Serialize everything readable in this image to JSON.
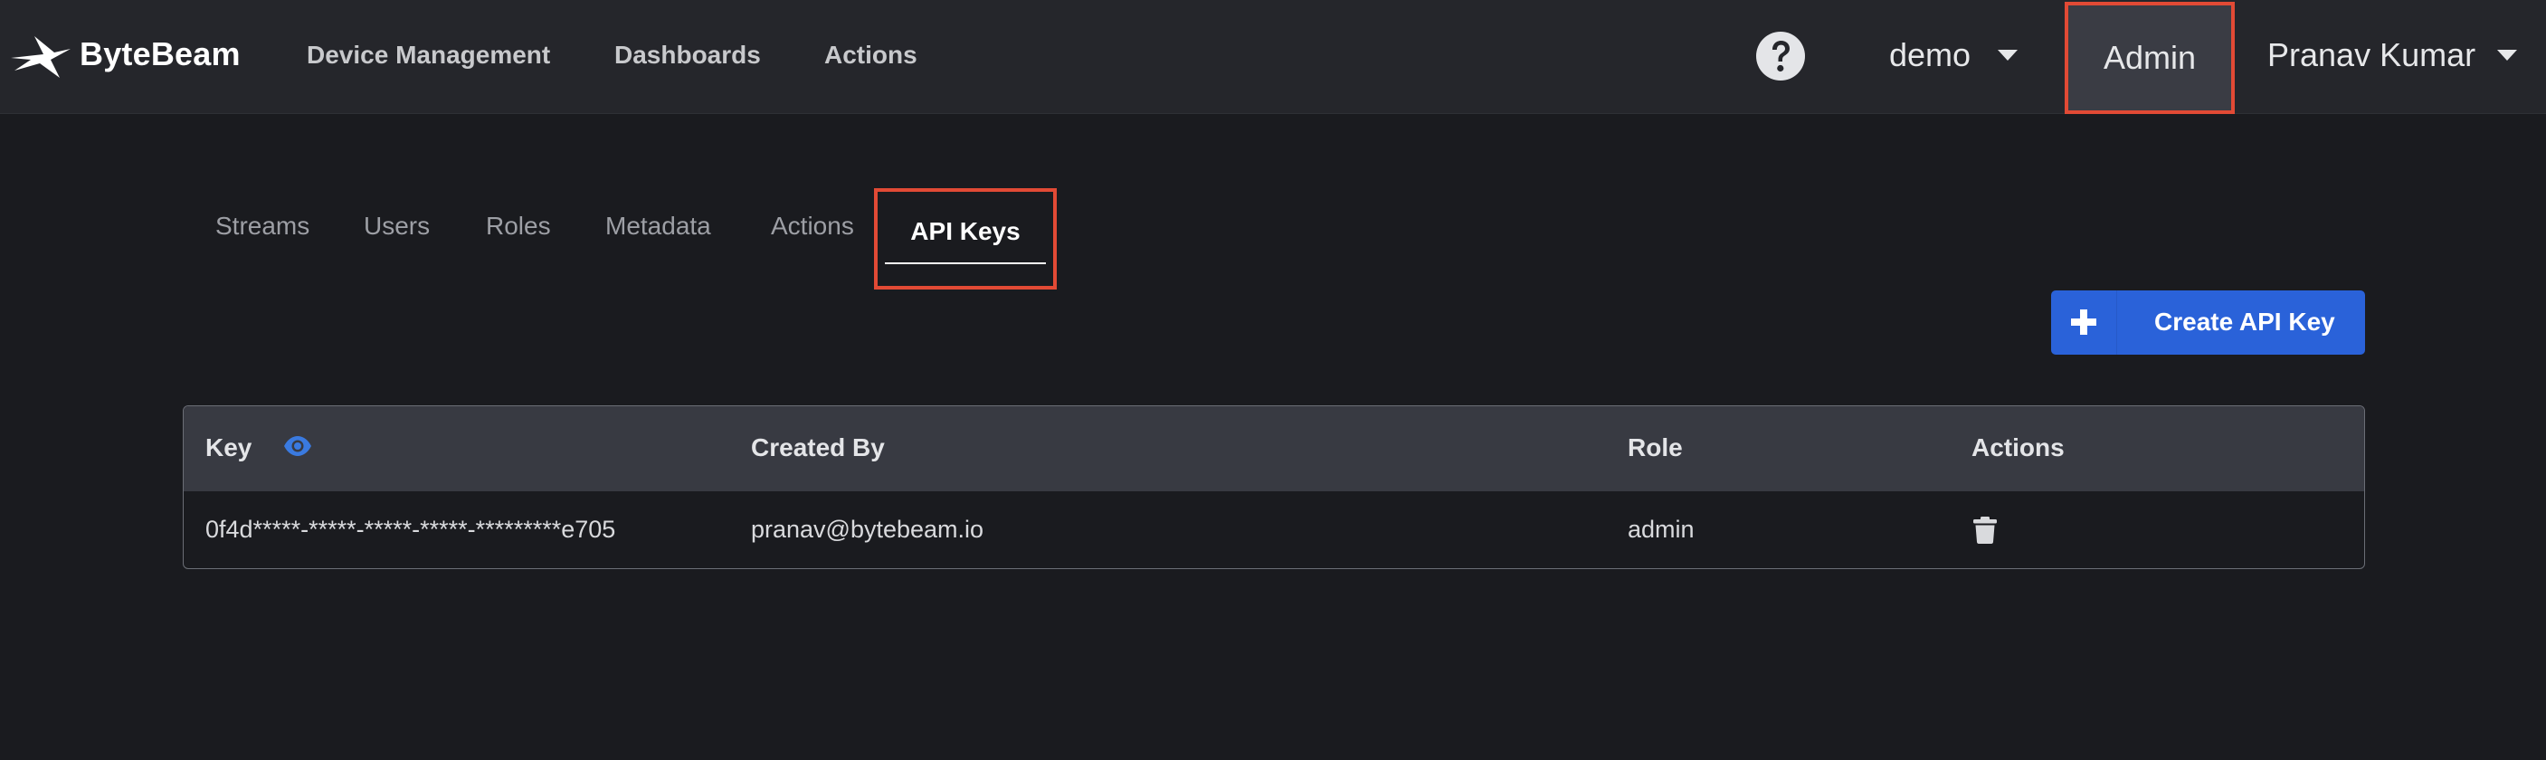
{
  "app": {
    "brand_name": "ByteBeam",
    "icons": {
      "logo": "bytebeam-bird-logo",
      "help": "question-circle-icon",
      "caret": "caret-down-icon",
      "reveal_key": "eye-icon",
      "delete": "trash-icon",
      "create": "plus-icon"
    }
  },
  "navbar": {
    "links": [
      "Device Management",
      "Dashboards",
      "Actions"
    ],
    "tenant": "demo",
    "admin_label": "Admin",
    "user_name": "Pranav Kumar"
  },
  "tabs": {
    "items": [
      "Streams",
      "Users",
      "Roles",
      "Metadata",
      "Actions",
      "API Keys"
    ],
    "active": "API Keys"
  },
  "create_button": {
    "label": "Create API Key"
  },
  "table": {
    "headers": [
      "Key",
      "Created By",
      "Role",
      "Actions"
    ],
    "rows": [
      {
        "key": "0f4d*****-*****-*****-*****-*********e705",
        "created_by": "pranav@bytebeam.io",
        "role": "admin"
      }
    ]
  },
  "colors": {
    "background": "#1a1b1f",
    "navbar": "#25262b",
    "highlight_box": "#e24a35",
    "primary_button": "#2a62d9",
    "eye_icon": "#3a7ae0",
    "table_header": "#383a42"
  }
}
